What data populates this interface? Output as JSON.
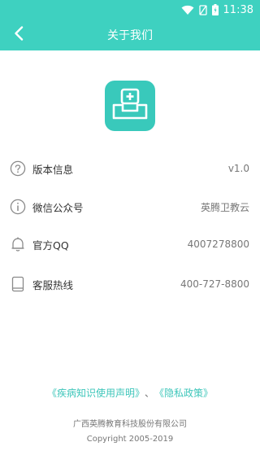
{
  "status_bar": {
    "time": "11:38",
    "icons": [
      "wifi-icon",
      "no-signal-icon",
      "battery-icon"
    ]
  },
  "header": {
    "title": "关于我们",
    "back_icon": "chevron-left-icon"
  },
  "logo": {
    "icon": "medical-box-icon",
    "color": "#39c9bb"
  },
  "info_rows": [
    {
      "icon": "question-circle-icon",
      "label": "版本信息",
      "value": "v1.0"
    },
    {
      "icon": "info-circle-icon",
      "label": "微信公众号",
      "value": "英腾卫教云"
    },
    {
      "icon": "bell-icon",
      "label": "官方QQ",
      "value": "4007278800"
    },
    {
      "icon": "tablet-icon",
      "label": "客服热线",
      "value": "400-727-8800"
    }
  ],
  "footer": {
    "link_disclaimer": "《疾病知识使用声明》",
    "separator": "、",
    "link_privacy": "《隐私政策》",
    "company": "广西英腾教育科技股份有限公司",
    "copyright": "Copyright 2005-2019"
  },
  "colors": {
    "accent": "#3ed1c0",
    "link": "#3ec6ba",
    "text": "#333333",
    "muted": "#777777"
  }
}
